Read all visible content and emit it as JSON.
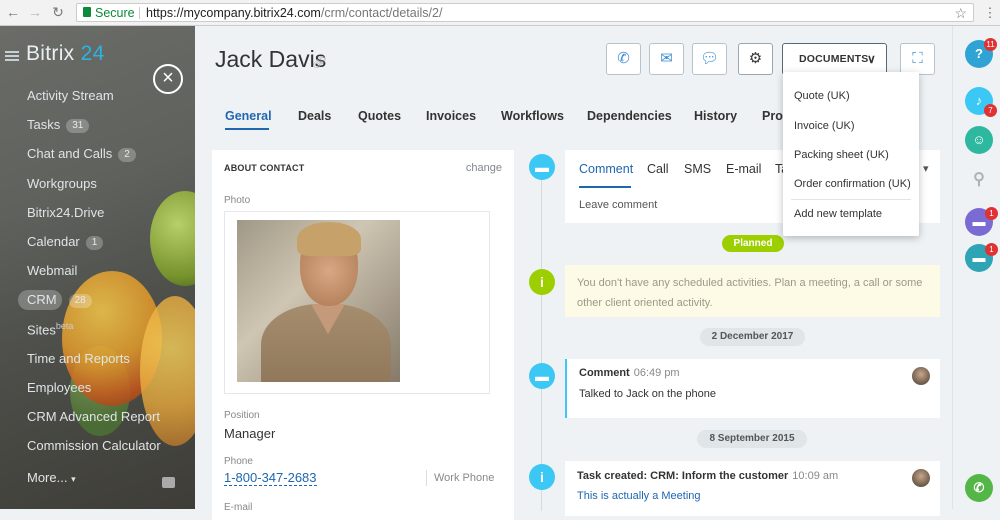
{
  "browser": {
    "secure_label": "Secure",
    "url_host": "https://mycompany.bitrix24.com",
    "url_path": "/crm/contact/details/2/"
  },
  "sidebar": {
    "brand": "Bitrix",
    "brand_num": "24",
    "items": [
      {
        "label": "Activity Stream"
      },
      {
        "label": "Tasks",
        "badge": "31"
      },
      {
        "label": "Chat and Calls",
        "badge": "2"
      },
      {
        "label": "Workgroups"
      },
      {
        "label": "Bitrix24.Drive"
      },
      {
        "label": "Calendar",
        "badge": "1"
      },
      {
        "label": "Webmail"
      },
      {
        "label": "CRM",
        "badge": "28"
      },
      {
        "label": "Sites",
        "sup": "beta"
      },
      {
        "label": "Time and Reports"
      },
      {
        "label": "Employees"
      },
      {
        "label": "CRM Advanced Report"
      },
      {
        "label": "Commission Calculator"
      },
      {
        "label": "More..."
      }
    ]
  },
  "header": {
    "title": "Jack Davis",
    "documents_label": "DOCUMENTS"
  },
  "tabs": [
    "General",
    "Deals",
    "Quotes",
    "Invoices",
    "Workflows",
    "Dependencies",
    "History",
    "Pro"
  ],
  "about": {
    "title": "ABOUT CONTACT",
    "change": "change",
    "photo_label": "Photo",
    "position_label": "Position",
    "position_value": "Manager",
    "phone_label": "Phone",
    "phone_value": "1-800-347-2683",
    "phone_type": "Work Phone",
    "email_label": "E-mail"
  },
  "composer": {
    "tabs": [
      "Comment",
      "Call",
      "SMS",
      "E-mail",
      "Ta"
    ],
    "placeholder": "Leave comment"
  },
  "timeline": {
    "planned": "Planned",
    "no_activities": "You don't have any scheduled activities. Plan a meeting, a call or some other client oriented activity.",
    "date1": "2 December 2017",
    "comment_title": "Comment",
    "comment_time": "06:49 pm",
    "comment_text": "Talked to Jack on the phone",
    "date2": "8 September 2015",
    "task_title": "Task created: CRM: Inform the customer",
    "task_time": "10:09 am",
    "task_text": "This is actually a Meeting"
  },
  "documents_menu": [
    "Quote (UK)",
    "Invoice (UK)",
    "Packing sheet (UK)",
    "Order confirmation (UK)",
    "Add new template"
  ],
  "rightbar": {
    "help_badge": "11",
    "notif_badge": "7",
    "chat_badge": "1",
    "open_badge": "1"
  },
  "colors": {
    "accent": "#2067b0",
    "timeline_blue": "#3bc8f5",
    "timeline_green": "#9dcf00"
  }
}
